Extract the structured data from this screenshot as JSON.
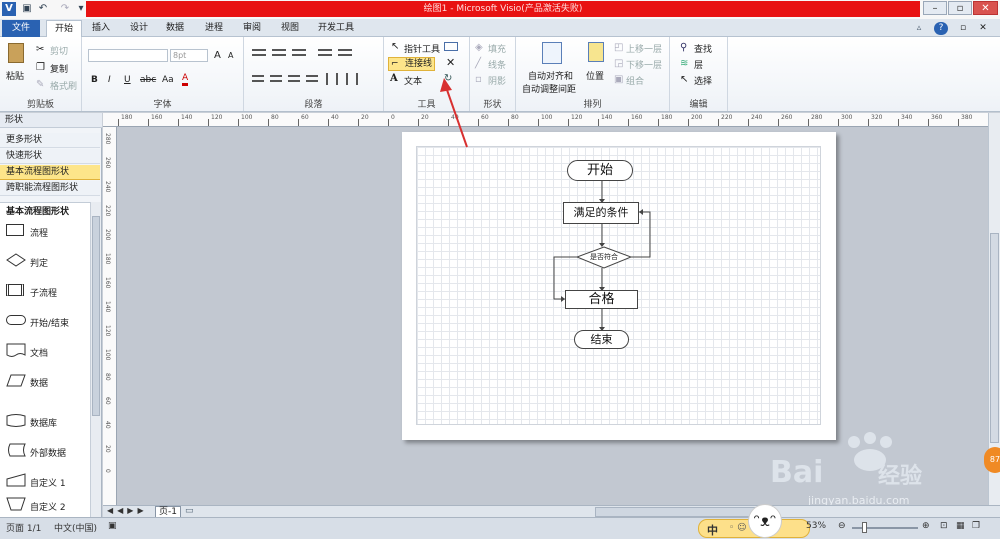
{
  "titlebar": {
    "title": "绘图1 - Microsoft Visio(产品激活失败)",
    "app_icon": "V",
    "undo_icon": "↶",
    "redo_icon": "↷",
    "save_icon": "💾",
    "minimize": "–",
    "restore": "▫",
    "close": "✕"
  },
  "tabs": [
    "文件",
    "开始",
    "插入",
    "设计",
    "数据",
    "进程",
    "审阅",
    "视图",
    "开发工具"
  ],
  "ribbon_right_icons": [
    "▵",
    "?",
    "▫",
    "✕"
  ],
  "clipboard": {
    "paste": "粘贴",
    "cut": "剪切",
    "copy": "复制",
    "format_painter": "格式刷",
    "label": "剪贴板"
  },
  "font": {
    "font_size": "8pt",
    "grow": "A",
    "shrink": "A",
    "bold": "B",
    "italic": "I",
    "underline": "U",
    "strike": "abc",
    "case": "Aa",
    "color": "A",
    "label": "字体"
  },
  "paragraph": {
    "label": "段落"
  },
  "tools": {
    "pointer": "指针工具",
    "connector": "连接线",
    "text": "文本",
    "close_icon": "✕",
    "label": "工具"
  },
  "shape": {
    "fill": "填充",
    "line": "线条",
    "shadow": "阴影",
    "label": "形状"
  },
  "arrange": {
    "auto_align_1": "自动对齐和",
    "auto_align_2": "自动调整间距",
    "position": "位置",
    "bring_forward": "上移一层",
    "send_backward": "下移一层",
    "group": "组合",
    "label": "排列"
  },
  "editing": {
    "find": "查找",
    "layers": "层",
    "select": "选择",
    "label": "编辑"
  },
  "shapes_pane": {
    "header": "形状",
    "rows": [
      "更多形状",
      "快速形状",
      "基本流程图形状",
      "跨职能流程图形状"
    ],
    "stencil_title": "基本流程图形状",
    "items": [
      "流程",
      "判定",
      "子流程",
      "开始/结束",
      "文档",
      "数据",
      "数据库",
      "外部数据",
      "自定义 1",
      "自定义 2"
    ]
  },
  "hruler_ticks": [
    "180",
    "160",
    "140",
    "120",
    "100",
    "80",
    "60",
    "40",
    "20",
    "0",
    "20",
    "40",
    "60",
    "80",
    "100",
    "120",
    "140",
    "160",
    "180",
    "200",
    "220",
    "240",
    "260",
    "280",
    "300",
    "320",
    "340",
    "360",
    "380"
  ],
  "vruler_ticks": [
    "280",
    "260",
    "240",
    "220",
    "200",
    "180",
    "160",
    "140",
    "120",
    "100",
    "80",
    "60",
    "40",
    "20",
    "0"
  ],
  "flowchart": {
    "start": "开始",
    "process": "满足的条件",
    "decision": "是否符合",
    "pass": "合格",
    "end": "结束"
  },
  "pagetabs": {
    "page": "页-1"
  },
  "status": {
    "page": "页面 1/1",
    "language": "中文(中国)",
    "zoom": "53%",
    "ime": "中"
  },
  "watermark": {
    "brand": "Bai",
    "brand2": "经验",
    "url": "jingyan.baidu.com",
    "badge": "87"
  },
  "colors": {
    "title_red": "#e81212",
    "file_tab": "#2a62b2",
    "highlight": "#fde58a",
    "arrow": "#d83030"
  }
}
